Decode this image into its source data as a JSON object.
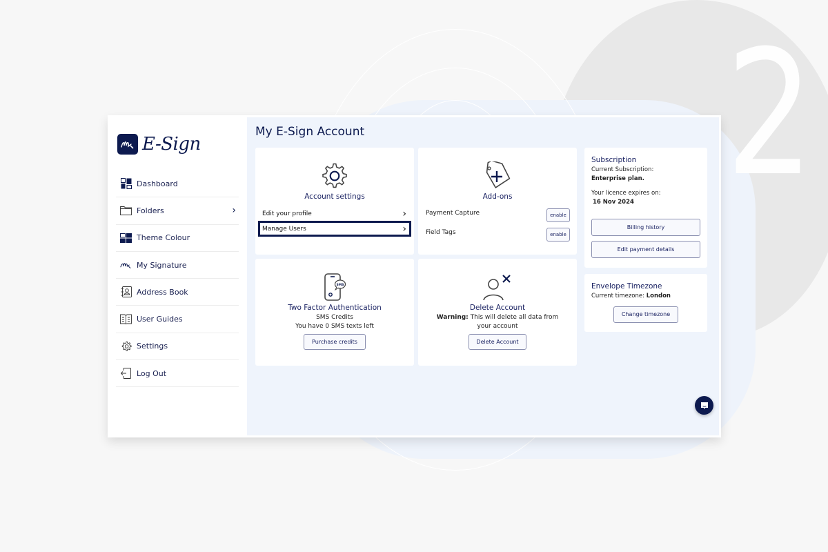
{
  "background": {
    "step_number": "2"
  },
  "brand": {
    "logo_mark": "Ms",
    "name": "E-Sign"
  },
  "sidebar": {
    "items": [
      {
        "label": "Dashboard",
        "icon": "dashboard-icon"
      },
      {
        "label": "Folders",
        "icon": "folder-icon",
        "chevron": "›"
      },
      {
        "label": "Theme Colour",
        "icon": "theme-colour-icon"
      },
      {
        "label": "My Signature",
        "icon": "signature-icon"
      },
      {
        "label": "Address Book",
        "icon": "address-book-icon"
      },
      {
        "label": "User Guides",
        "icon": "user-guides-icon"
      },
      {
        "label": "Settings",
        "icon": "settings-icon"
      },
      {
        "label": "Log Out",
        "icon": "log-out-icon"
      }
    ]
  },
  "main": {
    "title": "My E-Sign Account",
    "account_settings": {
      "title": "Account settings",
      "links": [
        {
          "label": "Edit your profile",
          "chevron": "›"
        },
        {
          "label": "Manage Users",
          "chevron": "›",
          "highlighted": true
        }
      ]
    },
    "addons": {
      "title": "Add-ons",
      "items": [
        {
          "label": "Payment Capture",
          "button": "enable"
        },
        {
          "label": "Field Tags",
          "button": "enable"
        }
      ]
    },
    "two_factor": {
      "title": "Two Factor Authentication",
      "subtitle": "SMS Credits",
      "status": "You have 0 SMS texts left",
      "button": "Purchase credits",
      "icon_badge": "SMS"
    },
    "delete_account": {
      "title": "Delete Account",
      "warning_label": "Warning:",
      "warning_text": " This will delete all data from your account",
      "button": "Delete Account"
    },
    "subscription": {
      "title": "Subscription",
      "current_label": "Current Subscription:",
      "current_value": "Enterprise plan.",
      "expiry_label": "Your licence expires on:",
      "expiry_value": "16 Nov 2024",
      "billing_button": "Billing history",
      "payment_button": "Edit payment details"
    },
    "timezone": {
      "title": "Envelope Timezone",
      "current_label": "Current timezone: ",
      "current_value": "London",
      "button": "Change timezone"
    }
  },
  "colors": {
    "brand_navy": "#0d1a4f",
    "main_bg": "#eff4fc",
    "page_bg": "#f7f7f7"
  }
}
